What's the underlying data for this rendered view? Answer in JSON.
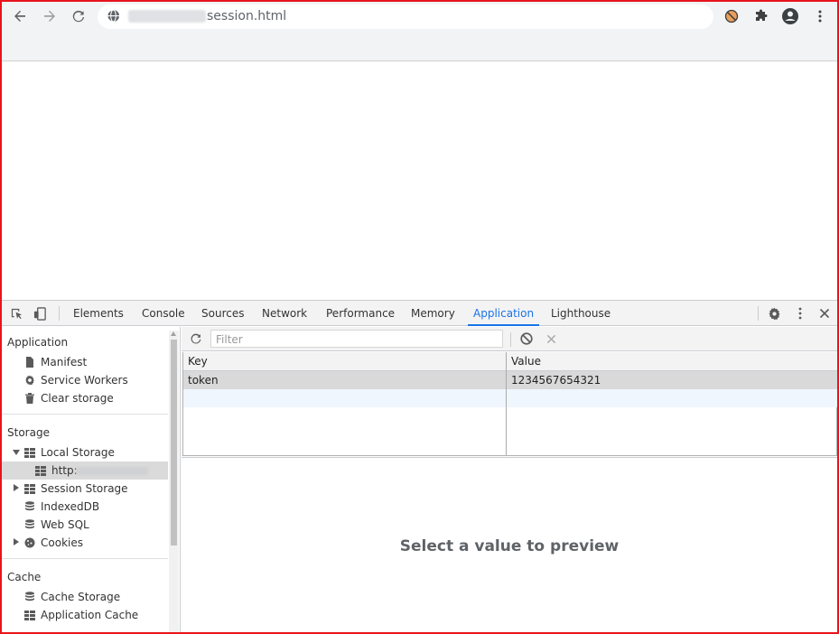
{
  "browser": {
    "url_path": "session.html",
    "icons": [
      "back-arrow-icon",
      "forward-arrow-icon",
      "reload-icon",
      "globe-icon",
      "blocked-extension-icon",
      "puzzle-icon",
      "account-icon",
      "kebab-menu-icon"
    ]
  },
  "devtools": {
    "tabs": [
      "Elements",
      "Console",
      "Sources",
      "Network",
      "Performance",
      "Memory",
      "Application",
      "Lighthouse"
    ],
    "active_tab": "Application",
    "accent": "#1a73e8"
  },
  "sidebar": {
    "application_heading": "Application",
    "application_items": [
      "Manifest",
      "Service Workers",
      "Clear storage"
    ],
    "storage_heading": "Storage",
    "local_storage": "Local Storage",
    "local_storage_origin": "http:",
    "session_storage": "Session Storage",
    "indexeddb": "IndexedDB",
    "websql": "Web SQL",
    "cookies": "Cookies",
    "cache_heading": "Cache",
    "cache_storage": "Cache Storage",
    "application_cache": "Application Cache"
  },
  "storage_view": {
    "filter_placeholder": "Filter",
    "columns": [
      "Key",
      "Value"
    ],
    "rows": [
      {
        "key": "token",
        "value": "1234567654321"
      }
    ],
    "preview_message": "Select a value to preview"
  }
}
